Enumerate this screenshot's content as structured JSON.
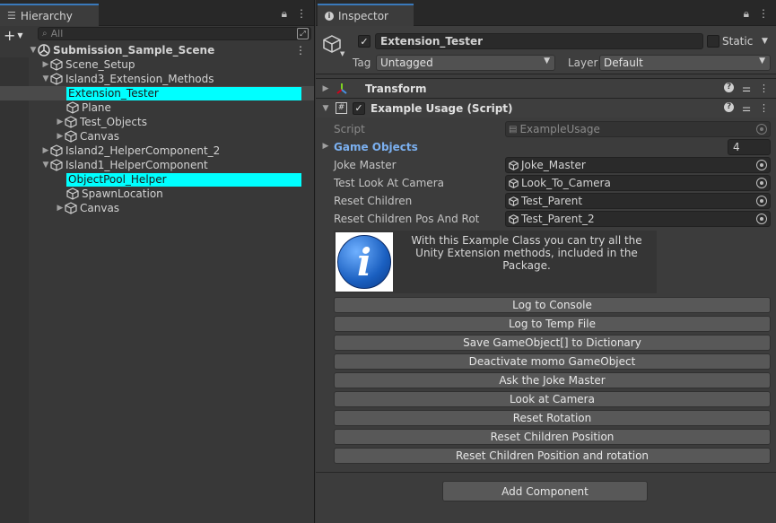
{
  "hierarchy": {
    "tab_label": "Hierarchy",
    "search_placeholder": "All",
    "scene_name": "Submission_Sample_Scene",
    "items": [
      {
        "label": "Scene_Setup"
      },
      {
        "label": "Island3_Extension_Methods"
      },
      {
        "label": "Extension_Tester"
      },
      {
        "label": "Plane"
      },
      {
        "label": "Test_Objects"
      },
      {
        "label": "Canvas"
      },
      {
        "label": "Island2_HelperComponent_2"
      },
      {
        "label": "Island1_HelperComponent"
      },
      {
        "label": "ObjectPool_Helper"
      },
      {
        "label": "SpawnLocation"
      },
      {
        "label": "Canvas"
      }
    ]
  },
  "inspector": {
    "tab_label": "Inspector",
    "object_name": "Extension_Tester",
    "static_label": "Static",
    "tag_label": "Tag",
    "tag_value": "Untagged",
    "layer_label": "Layer",
    "layer_value": "Default",
    "transform_title": "Transform",
    "script_component": {
      "title": "Example Usage (Script)",
      "script_label": "Script",
      "script_value": "ExampleUsage",
      "game_objects_label": "Game Objects",
      "game_objects_count": "4",
      "fields": [
        {
          "label": "Joke Master",
          "value": "Joke_Master"
        },
        {
          "label": "Test Look At Camera",
          "value": "Look_To_Camera"
        },
        {
          "label": "Reset Children",
          "value": "Test_Parent"
        },
        {
          "label": "Reset Children Pos And Rot",
          "value": "Test_Parent_2"
        }
      ],
      "info_text_line1": "With this Example Class you can try all the",
      "info_text_line2": "Unity Extension methods, included in the Package.",
      "info_icon_letter": "i",
      "buttons": [
        "Log to Console",
        "Log to Temp File",
        "Save GameObject[] to Dictionary",
        "Deactivate momo GameObject",
        "Ask the Joke Master",
        "Look at Camera",
        "Reset Rotation",
        "Reset Children Position",
        "Reset Children Position and rotation"
      ]
    },
    "add_component_label": "Add Component"
  },
  "colors": {
    "selection_highlight": "#00ffff",
    "tab_accent": "#3a79bb",
    "link_blue": "#7bb0f0"
  }
}
